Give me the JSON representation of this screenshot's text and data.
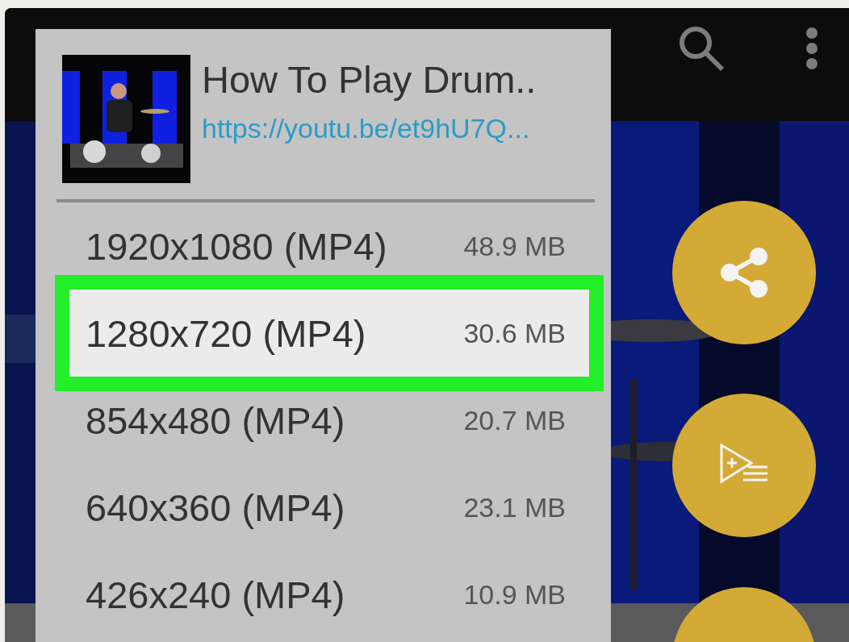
{
  "video": {
    "title": "How To Play Drum..",
    "link": "https://youtu.be/et9hU7Q..."
  },
  "formats": [
    {
      "resolution": "1920x1080 (MP4)",
      "size": "48.9 MB",
      "selected": false
    },
    {
      "resolution": "1280x720 (MP4)",
      "size": "30.6 MB",
      "selected": true
    },
    {
      "resolution": "854x480 (MP4)",
      "size": "20.7 MB",
      "selected": false
    },
    {
      "resolution": "640x360 (MP4)",
      "size": "23.1 MB",
      "selected": false
    },
    {
      "resolution": "426x240 (MP4)",
      "size": "10.9 MB",
      "selected": false
    }
  ],
  "actions": [
    {
      "kind": "share"
    },
    {
      "kind": "add_to_playlist"
    },
    {
      "kind": "more"
    }
  ]
}
